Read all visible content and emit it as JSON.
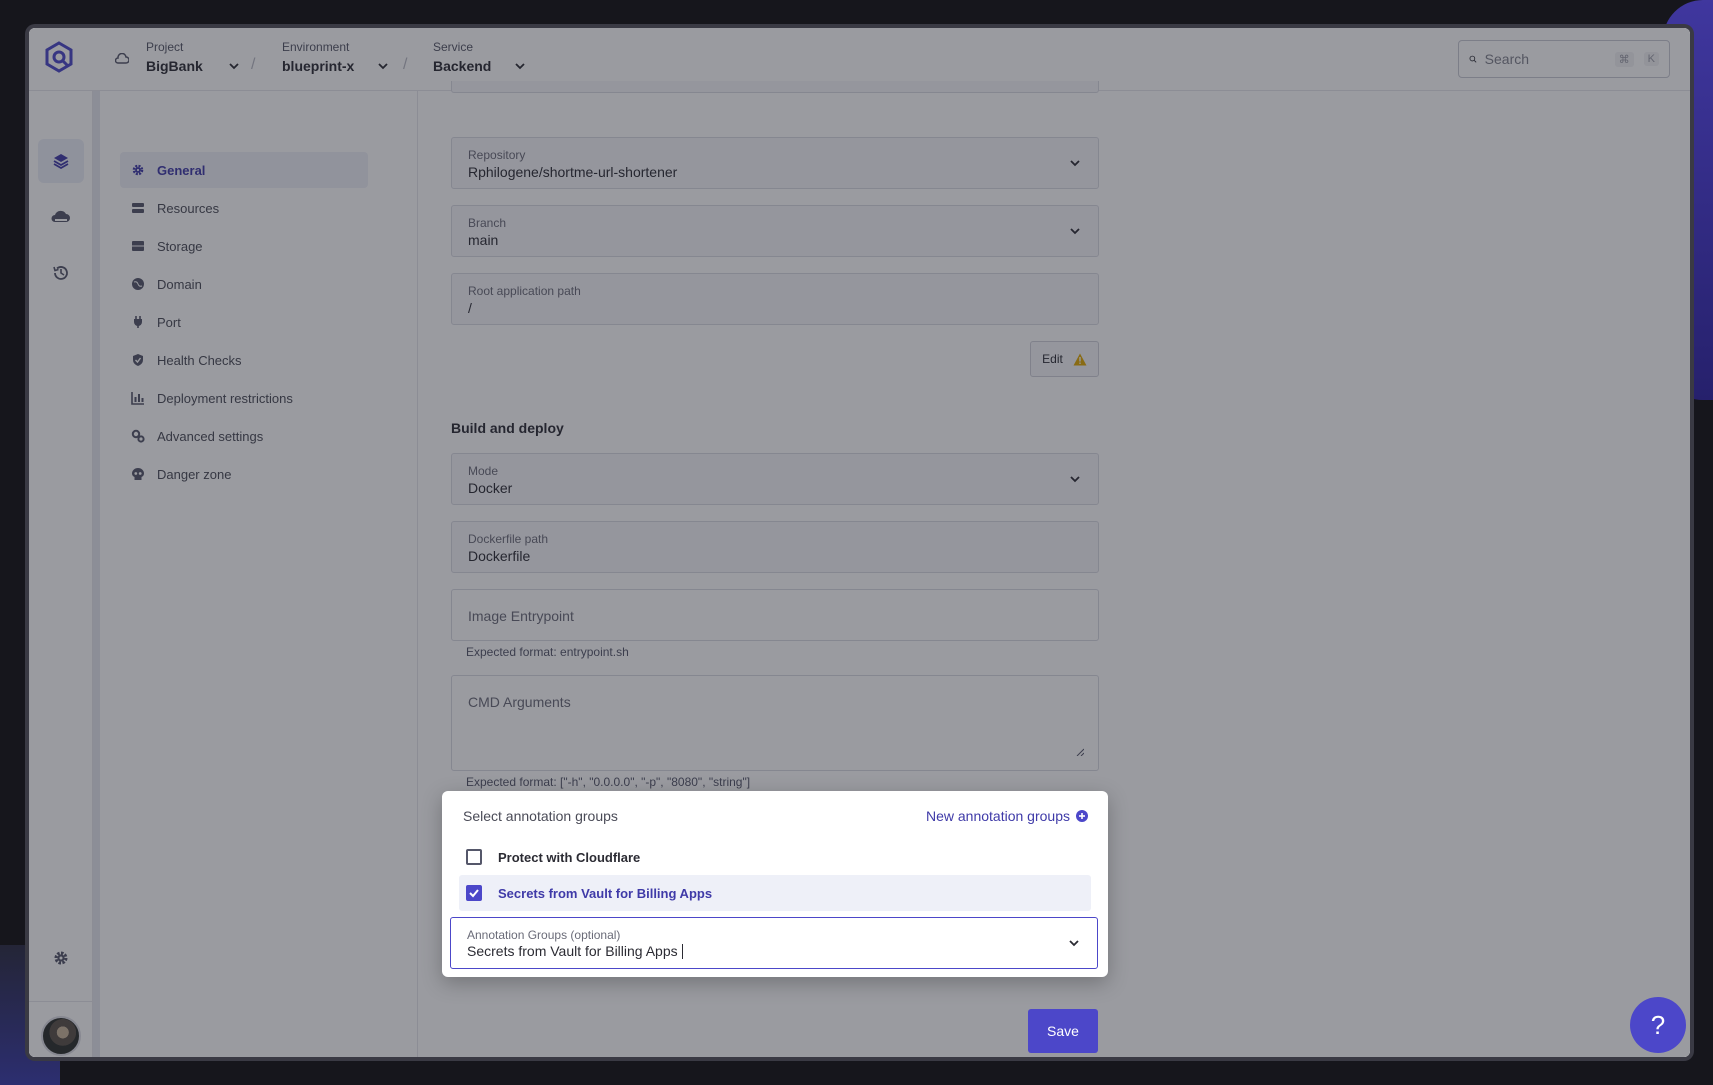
{
  "topbar": {
    "project": {
      "label": "Project",
      "value": "BigBank"
    },
    "environment": {
      "label": "Environment",
      "value": "blueprint-x"
    },
    "service": {
      "label": "Service",
      "value": "Backend"
    },
    "separator": "/",
    "search": {
      "placeholder": "Search",
      "shortcut_mod": "⌘",
      "shortcut_key": "K"
    }
  },
  "sidenav": {
    "items": [
      {
        "label": "General",
        "icon": "gear-icon",
        "active": true
      },
      {
        "label": "Resources",
        "icon": "server-icon"
      },
      {
        "label": "Storage",
        "icon": "storage-icon"
      },
      {
        "label": "Domain",
        "icon": "globe-icon"
      },
      {
        "label": "Port",
        "icon": "plug-icon"
      },
      {
        "label": "Health Checks",
        "icon": "shield-icon"
      },
      {
        "label": "Deployment restrictions",
        "icon": "chart-icon"
      },
      {
        "label": "Advanced settings",
        "icon": "gears-icon"
      },
      {
        "label": "Danger zone",
        "icon": "skull-icon"
      }
    ]
  },
  "form": {
    "repository": {
      "label": "Repository",
      "value": "Rphilogene/shortme-url-shortener"
    },
    "branch": {
      "label": "Branch",
      "value": "main"
    },
    "root_path": {
      "label": "Root application path",
      "value": "/"
    },
    "edit_label": "Edit",
    "build_title": "Build and deploy",
    "mode": {
      "label": "Mode",
      "value": "Docker"
    },
    "dockerfile": {
      "label": "Dockerfile path",
      "value": "Dockerfile"
    },
    "entrypoint": {
      "placeholder": "Image Entrypoint",
      "hint": "Expected format: entrypoint.sh"
    },
    "cmd": {
      "placeholder": "CMD Arguments",
      "hint": "Expected format: [\"-h\", \"0.0.0.0\", \"-p\", \"8080\", \"string\"]"
    },
    "save_label": "Save"
  },
  "popover": {
    "title": "Select annotation groups",
    "new_link": "New annotation groups",
    "options": [
      {
        "label": "Protect with Cloudflare",
        "checked": false
      },
      {
        "label": "Secrets from Vault for Billing Apps",
        "checked": true
      }
    ],
    "annotation_field": {
      "label": "Annotation Groups (optional)",
      "value": "Secrets from Vault for Billing Apps"
    }
  },
  "help_label": "?",
  "colors": {
    "accent": "#4c47c9",
    "warning": "#e0a800"
  }
}
